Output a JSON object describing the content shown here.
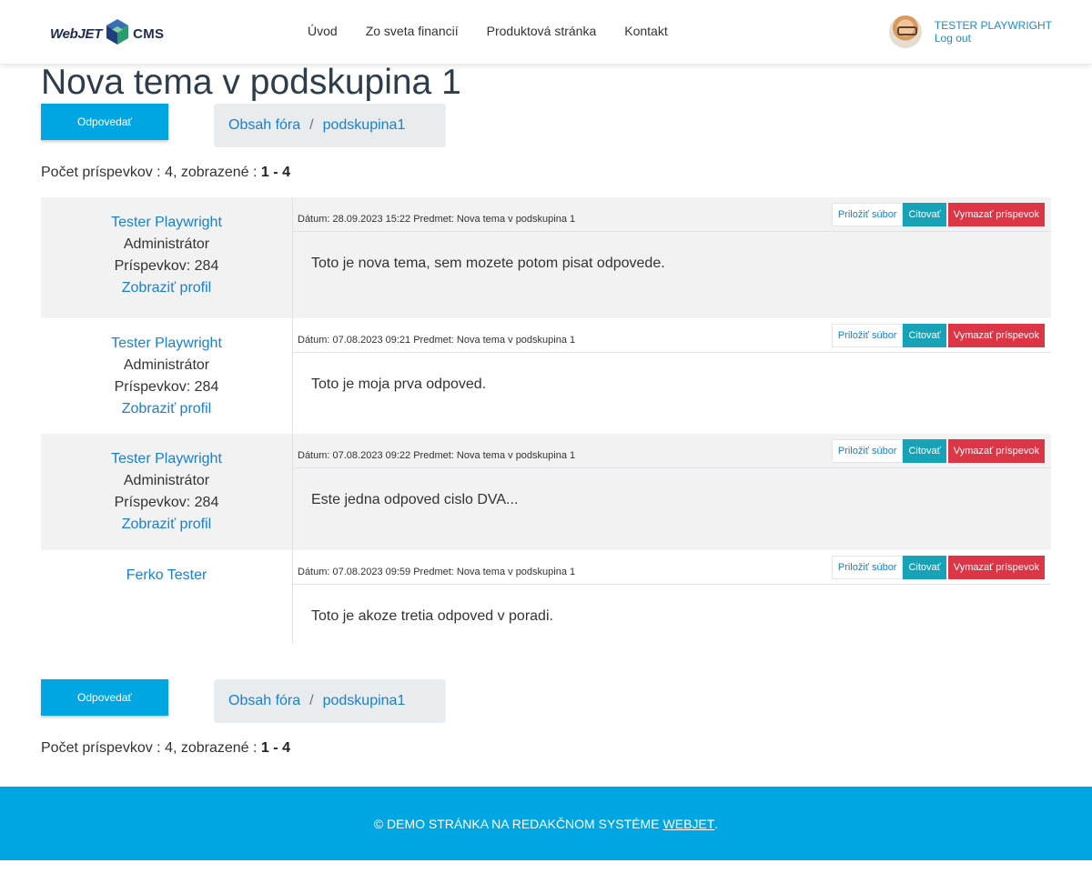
{
  "header": {
    "logo": {
      "part1": "WebJET",
      "part2": "CMS"
    },
    "nav": [
      "Úvod",
      "Zo sveta financií",
      "Produktová stránka",
      "Kontakt"
    ],
    "user": {
      "name": "TESTER PLAYWRIGHT",
      "logout": "Log out"
    }
  },
  "page": {
    "title": "Nova tema v podskupina 1",
    "reply_label": "Odpovedať",
    "breadcrumb": [
      "Obsah fóra",
      "podskupina1"
    ],
    "breadcrumb_sep": "/",
    "count_prefix": "Počet príspevkov : 4, zobrazené :",
    "count_from": "1",
    "count_dash": "-",
    "count_to": "4"
  },
  "actions": {
    "attach": "Priložiť súbor",
    "quote": "Citovať",
    "delete": "Vymazať príspevok"
  },
  "posts": [
    {
      "author": "Tester Playwright",
      "role": "Administrátor",
      "post_count": "Príspevkov: 284",
      "profile": "Zobraziť profil",
      "meta": "Dátum: 28.09.2023 15:22 Predmet: Nova tema v podskupina 1",
      "body": "Toto je nova tema, sem mozete potom pisat odpovede."
    },
    {
      "author": "Tester Playwright",
      "role": "Administrátor",
      "post_count": "Príspevkov: 284",
      "profile": "Zobraziť profil",
      "meta": "Dátum: 07.08.2023 09:21 Predmet: Nova tema v podskupina 1",
      "body": "Toto je moja prva odpoved."
    },
    {
      "author": "Tester Playwright",
      "role": "Administrátor",
      "post_count": "Príspevkov: 284",
      "profile": "Zobraziť profil",
      "meta": "Dátum: 07.08.2023 09:22 Predmet: Nova tema v podskupina 1",
      "body": "Este jedna odpoved cislo DVA..."
    },
    {
      "author": "Ferko Tester",
      "meta": "Dátum: 07.08.2023 09:59 Predmet: Nova tema v podskupina 1",
      "body": "Toto je akoze tretia odpoved v poradi."
    }
  ],
  "footer": {
    "text": "© DEMO STRÁNKA NA REDAKČNOM SYSTÉME",
    "link": "WEBJET",
    "end": "."
  },
  "colors": {
    "accent": "#00a6e2",
    "link": "#1a7fd0",
    "quote": "#17a2b8",
    "delete": "#dc3545"
  }
}
